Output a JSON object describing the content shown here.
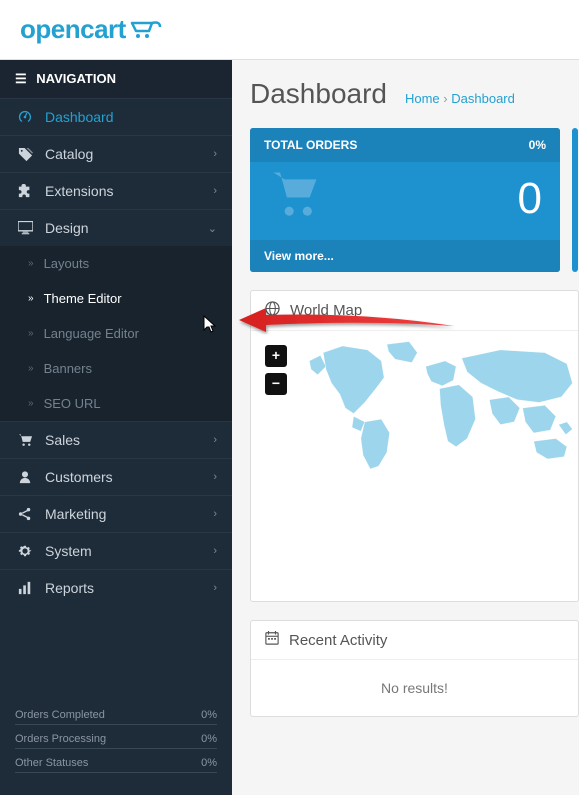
{
  "logo": {
    "text": "opencart"
  },
  "sidebar": {
    "header": "NAVIGATION",
    "items": [
      {
        "label": "Dashboard"
      },
      {
        "label": "Catalog"
      },
      {
        "label": "Extensions"
      },
      {
        "label": "Design"
      },
      {
        "label": "Sales"
      },
      {
        "label": "Customers"
      },
      {
        "label": "Marketing"
      },
      {
        "label": "System"
      },
      {
        "label": "Reports"
      }
    ],
    "design_sub": [
      {
        "label": "Layouts"
      },
      {
        "label": "Theme Editor"
      },
      {
        "label": "Language Editor"
      },
      {
        "label": "Banners"
      },
      {
        "label": "SEO URL"
      }
    ],
    "stats": [
      {
        "label": "Orders Completed",
        "value": "0%"
      },
      {
        "label": "Orders Processing",
        "value": "0%"
      },
      {
        "label": "Other Statuses",
        "value": "0%"
      }
    ]
  },
  "page": {
    "title": "Dashboard"
  },
  "breadcrumb": {
    "home": "Home",
    "sep": "›",
    "current": "Dashboard"
  },
  "tile_orders": {
    "title": "TOTAL ORDERS",
    "pct": "0%",
    "value": "0",
    "footer": "View more..."
  },
  "worldmap": {
    "title": "World Map",
    "zoom_in": "+",
    "zoom_out": "−"
  },
  "activity": {
    "title": "Recent Activity",
    "empty": "No results!"
  }
}
